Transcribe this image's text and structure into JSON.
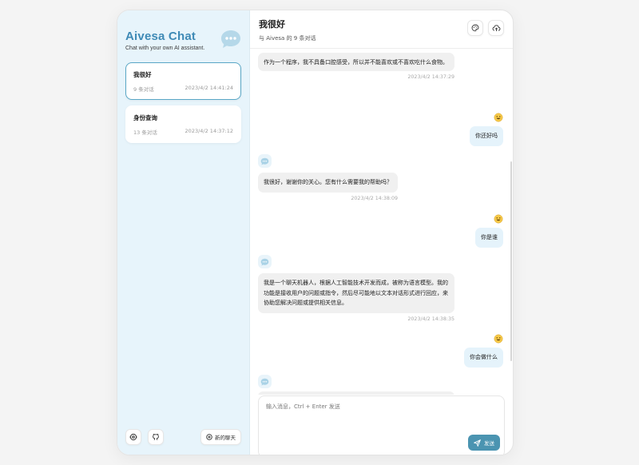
{
  "brand": {
    "title": "Aivesa Chat",
    "subtitle": "Chat with your own AI assistant."
  },
  "sessions": [
    {
      "title": "我很好",
      "count": "9 条对话",
      "time": "2023/4/2 14:41:24",
      "selected": true
    },
    {
      "title": "身份查询",
      "count": "13 条对话",
      "time": "2023/4/2 14:37:12",
      "selected": false
    }
  ],
  "sidebar_footer": {
    "new_chat_label": "新的聊天"
  },
  "header": {
    "title": "我很好",
    "subtitle": "与 Aivesa 的 9 条对话"
  },
  "messages": [
    {
      "role": "bot",
      "text": "作为一个程序，我不具备口腔感受，所以并不能喜欢或不喜欢吃什么食物。",
      "time": "2023/4/2 14:37:29"
    },
    {
      "role": "user",
      "emoji": "😀",
      "text": "你还好吗"
    },
    {
      "role": "bot",
      "text": "我很好，谢谢你的关心。您有什么需要我的帮助吗？",
      "time": "2023/4/2 14:38:09"
    },
    {
      "role": "user",
      "emoji": "😀",
      "text": "你是谁"
    },
    {
      "role": "bot",
      "text": "我是一个聊天机器人，根据人工智能技术开发而成，被称为语言模型。我的功能是接收用户的问题或指令，然后尽可能地以文本对话形式进行回应，来协助您解决问题或提供相关信息。",
      "time": "2023/4/2 14:38:35"
    },
    {
      "role": "user",
      "emoji": "😀",
      "text": "你会做什么"
    }
  ],
  "composer": {
    "placeholder": "输入消息，Ctrl + Enter 发送",
    "send_label": "发送"
  },
  "colors": {
    "accent": "#4b94b1",
    "sidebar_bg": "#e7f4fb",
    "brand": "#3e8ab6"
  }
}
